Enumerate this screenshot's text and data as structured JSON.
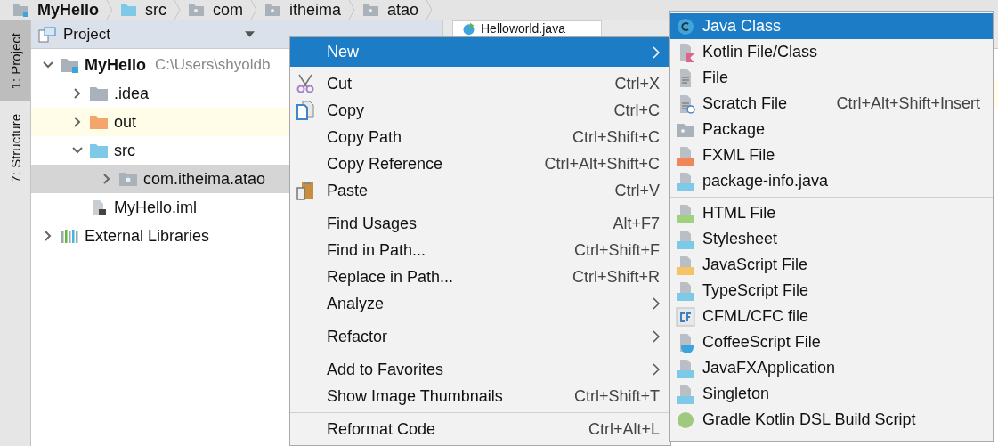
{
  "breadcrumbs": [
    {
      "label": "MyHello",
      "kind": "module"
    },
    {
      "label": "src",
      "kind": "source"
    },
    {
      "label": "com",
      "kind": "package"
    },
    {
      "label": "itheima",
      "kind": "package"
    },
    {
      "label": "atao",
      "kind": "package"
    }
  ],
  "tool_strip": [
    {
      "label": "1: Project",
      "selected": true
    },
    {
      "label": "7: Structure",
      "selected": false
    }
  ],
  "project_panel": {
    "title": "Project",
    "tree": [
      {
        "label": "MyHello",
        "path": "C:\\Users\\shyoldb",
        "kind": "module",
        "expanded": true,
        "selected": false,
        "highlighted": false,
        "children": [
          {
            "label": ".idea",
            "kind": "folder",
            "expanded": false,
            "selected": false,
            "highlighted": false
          },
          {
            "label": "out",
            "kind": "excluded",
            "expanded": false,
            "selected": false,
            "highlighted": true
          },
          {
            "label": "src",
            "kind": "source",
            "expanded": true,
            "selected": false,
            "highlighted": false,
            "children": [
              {
                "label": "com.itheima.atao",
                "kind": "package",
                "expanded": false,
                "selected": true,
                "highlighted": false
              }
            ]
          },
          {
            "label": "MyHello.iml",
            "kind": "iml",
            "selected": false,
            "highlighted": false
          }
        ]
      },
      {
        "label": "External Libraries",
        "kind": "libraries",
        "expanded": false,
        "selected": false,
        "highlighted": false
      }
    ]
  },
  "editor_tab": {
    "label": "Helloworld.java"
  },
  "context_menu": [
    {
      "kind": "item",
      "label": "New",
      "submenu": true,
      "selected": true
    },
    {
      "kind": "separator"
    },
    {
      "kind": "item",
      "label": "Cut",
      "shortcut": "Ctrl+X",
      "selected": false
    },
    {
      "kind": "item",
      "label": "Copy",
      "shortcut": "Ctrl+C",
      "selected": false
    },
    {
      "kind": "item",
      "label": "Copy Path",
      "shortcut": "Ctrl+Shift+C",
      "selected": false
    },
    {
      "kind": "item",
      "label": "Copy Reference",
      "shortcut": "Ctrl+Alt+Shift+C",
      "selected": false
    },
    {
      "kind": "item",
      "label": "Paste",
      "shortcut": "Ctrl+V",
      "selected": false
    },
    {
      "kind": "separator"
    },
    {
      "kind": "item",
      "label": "Find Usages",
      "shortcut": "Alt+F7",
      "selected": false
    },
    {
      "kind": "item",
      "label": "Find in Path...",
      "shortcut": "Ctrl+Shift+F",
      "selected": false
    },
    {
      "kind": "item",
      "label": "Replace in Path...",
      "shortcut": "Ctrl+Shift+R",
      "selected": false
    },
    {
      "kind": "item",
      "label": "Analyze",
      "submenu": true,
      "selected": false
    },
    {
      "kind": "separator"
    },
    {
      "kind": "item",
      "label": "Refactor",
      "submenu": true,
      "selected": false
    },
    {
      "kind": "separator"
    },
    {
      "kind": "item",
      "label": "Add to Favorites",
      "submenu": true,
      "selected": false
    },
    {
      "kind": "item",
      "label": "Show Image Thumbnails",
      "shortcut": "Ctrl+Shift+T",
      "selected": false
    },
    {
      "kind": "separator"
    },
    {
      "kind": "item",
      "label": "Reformat Code",
      "shortcut": "Ctrl+Alt+L",
      "selected": false
    }
  ],
  "new_submenu": [
    {
      "kind": "item",
      "label": "Java Class",
      "selected": true
    },
    {
      "kind": "item",
      "label": "Kotlin File/Class",
      "selected": false
    },
    {
      "kind": "item",
      "label": "File",
      "selected": false
    },
    {
      "kind": "item",
      "label": "Scratch File",
      "shortcut": "Ctrl+Alt+Shift+Insert",
      "selected": false
    },
    {
      "kind": "item",
      "label": "Package",
      "selected": false
    },
    {
      "kind": "item",
      "label": "FXML File",
      "selected": false
    },
    {
      "kind": "item",
      "label": "package-info.java",
      "selected": false
    },
    {
      "kind": "separator"
    },
    {
      "kind": "item",
      "label": "HTML File",
      "selected": false
    },
    {
      "kind": "item",
      "label": "Stylesheet",
      "selected": false
    },
    {
      "kind": "item",
      "label": "JavaScript File",
      "selected": false
    },
    {
      "kind": "item",
      "label": "TypeScript File",
      "selected": false
    },
    {
      "kind": "item",
      "label": "CFML/CFC file",
      "selected": false
    },
    {
      "kind": "item",
      "label": "CoffeeScript File",
      "selected": false
    },
    {
      "kind": "item",
      "label": "JavaFXApplication",
      "selected": false
    },
    {
      "kind": "item",
      "label": "Singleton",
      "selected": false
    },
    {
      "kind": "item",
      "label": "Gradle Kotlin DSL Build Script",
      "selected": false
    }
  ]
}
